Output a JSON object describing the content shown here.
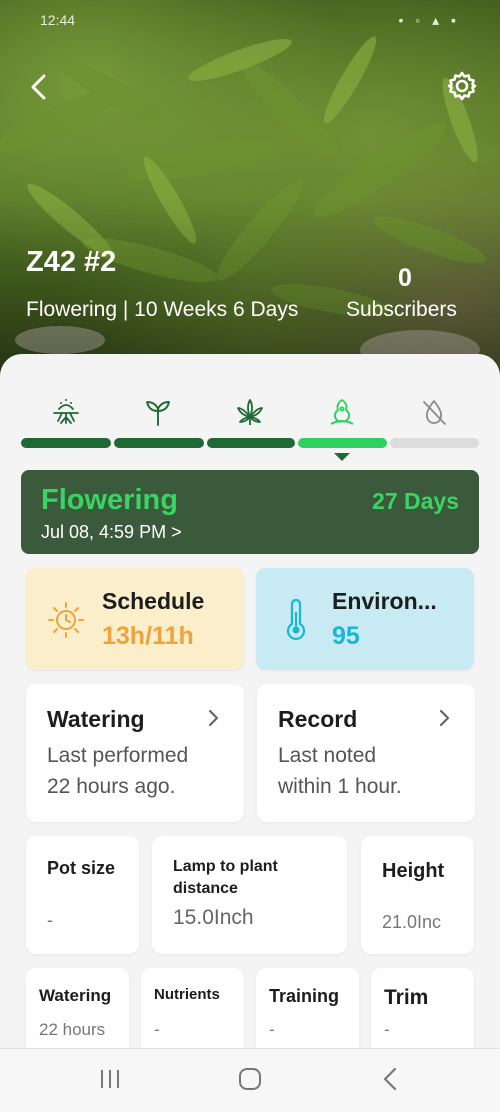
{
  "status_bar": {
    "time": "12:44"
  },
  "header": {
    "plant_name": "Z42 #2",
    "stage_text": "Flowering | 10 Weeks 6 Days",
    "subscribers_count": "0",
    "subscribers_label": "Subscribers",
    "back_icon": "chevron-left-icon",
    "settings_icon": "gear-icon"
  },
  "stages": [
    {
      "icon": "germination-icon"
    },
    {
      "icon": "seedling-icon"
    },
    {
      "icon": "vegetative-leaf-icon"
    },
    {
      "icon": "flowering-bud-icon"
    },
    {
      "icon": "harvest-drying-icon"
    }
  ],
  "stage_card": {
    "title": "Flowering",
    "date": "Jul 08, 4:59 PM >",
    "days": "27 Days"
  },
  "schedule": {
    "label": "Schedule",
    "value": "13h/11h"
  },
  "environment": {
    "label": "Environ...",
    "value": "95"
  },
  "watering_card": {
    "title": "Watering",
    "line1": "Last performed",
    "line2": "22 hours ago."
  },
  "record_card": {
    "title": "Record",
    "line1": "Last noted",
    "line2": "within 1 hour."
  },
  "stats": {
    "pot_size": {
      "label": "Pot size",
      "value": "-"
    },
    "lamp_distance": {
      "label_line1": "Lamp to plant",
      "label_line2": "distance",
      "value": "15.0Inch"
    },
    "height": {
      "label": "Height",
      "value": "21.0Inc"
    }
  },
  "activity": {
    "watering": {
      "label": "Watering",
      "value": "22 hours"
    },
    "nutrients": {
      "label": "Nutrients",
      "value": "-"
    },
    "training": {
      "label": "Training",
      "value": "-"
    },
    "trim": {
      "label": "Trim",
      "value": "-"
    }
  },
  "colors": {
    "stage_done": "#1f6a34",
    "stage_current": "#2ed15e",
    "stage_pending": "#dcdcdc",
    "stage_card_bg": "#3b5a3b",
    "accent_green": "#39d463",
    "schedule_bg": "#fbeecb",
    "schedule_value": "#f0a23b",
    "environment_bg": "#c7eaf3",
    "environment_value": "#19b7d6"
  },
  "nav": [
    "recent-apps-icon",
    "home-icon",
    "back-icon"
  ]
}
